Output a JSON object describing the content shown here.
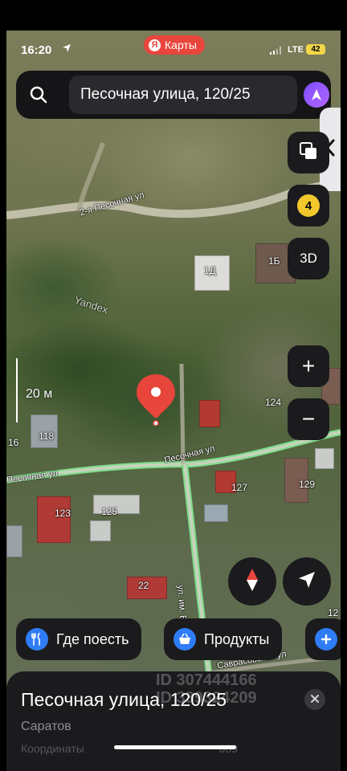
{
  "status_bar": {
    "time": "16:20",
    "network": "LTE",
    "battery": "42"
  },
  "app_badge": {
    "logo_letter": "Я",
    "label": "Карты"
  },
  "search": {
    "query": "Песочная улица, 120/25"
  },
  "map_controls": {
    "layers_icon": "layers-icon",
    "traffic_level": "4",
    "mode_3d": "3D",
    "zoom_in": "+",
    "zoom_out": "−"
  },
  "map": {
    "scale_label": "20 м",
    "provider_watermark": "Yandex",
    "streets": [
      "2-я Песочная ул",
      "Песочная ул",
      "Песочная ул",
      "ул. им. В.Г.",
      "Саврасовская ул"
    ],
    "house_numbers": [
      "1Д",
      "1Б",
      "124",
      "118",
      "16",
      "127",
      "129",
      "123",
      "125",
      "22",
      "12"
    ]
  },
  "quick_chips": [
    {
      "label": "Где поесть",
      "icon": "fork-knife-icon"
    },
    {
      "label": "Продукты",
      "icon": "basket-icon"
    }
  ],
  "place_card": {
    "title": "Песочная улица, 120/25",
    "city": "Саратов",
    "coords_prefix": "Координаты",
    "coords_suffix": "089"
  },
  "listing_watermark": {
    "line1": "ID 307444166",
    "line2": "ID 339324209"
  },
  "colors": {
    "pin": "#e8453c",
    "road_highlight": "#7ddc8a",
    "accent_blue": "#2f7df6",
    "traffic_yellow": "#f3c82d"
  }
}
